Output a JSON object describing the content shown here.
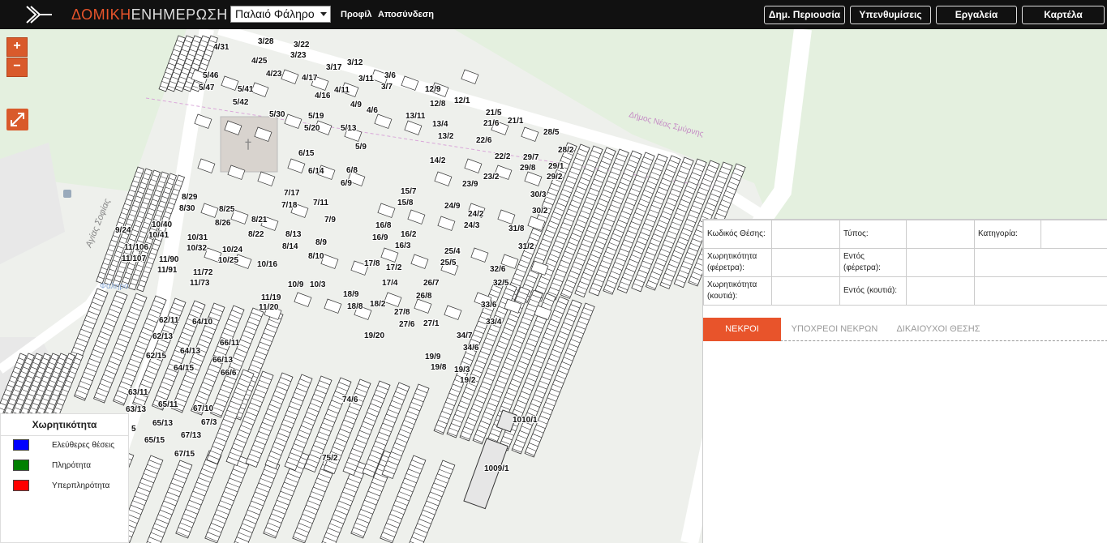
{
  "header": {
    "brand_part1": "ΔΟΜΙΚΗ",
    "brand_part2": "ΕΝΗΜΕΡΩΣΗ",
    "location_select": "Παλαιό Φάληρο",
    "profile_link": "Προφίλ",
    "logout_link": "Αποσύνδεση",
    "buttons": [
      "Δημ. Περιουσία",
      "Υπενθυμίσεις",
      "Εργαλεία",
      "Καρτέλα"
    ]
  },
  "map": {
    "zoom_in": "+",
    "zoom_out": "−",
    "street_labels": [
      "Αγίας Σοφίας",
      "Δήμος Νέας Σμύρνης",
      "Φαληρο"
    ],
    "plot_labels": [
      "3/28",
      "3/22",
      "3/23",
      "4/31",
      "4/25",
      "4/23",
      "5/46",
      "5/47",
      "5/41",
      "5/42",
      "4/17",
      "4/16",
      "4/11",
      "3/17",
      "3/12",
      "3/11",
      "3/6",
      "3/7",
      "4/9",
      "4/6",
      "5/30",
      "5/19",
      "5/20",
      "5/13",
      "5/9",
      "12/9",
      "12/8",
      "12/1",
      "13/11",
      "13/4",
      "13/2",
      "21/5",
      "21/6",
      "21/1",
      "22/6",
      "22/2",
      "28/5",
      "28/2",
      "29/7",
      "29/8",
      "29/1",
      "29/2",
      "14/2",
      "6/15",
      "6/14",
      "6/8",
      "6/9",
      "23/2",
      "23/9",
      "30/3",
      "30/2",
      "7/17",
      "7/18",
      "7/11",
      "7/9",
      "8/29",
      "8/30",
      "8/25",
      "8/26",
      "8/21",
      "8/22",
      "8/13",
      "8/14",
      "8/9",
      "8/10",
      "15/7",
      "15/8",
      "24/9",
      "24/2",
      "24/3",
      "31/8",
      "31/2",
      "9/24",
      "10/40",
      "10/41",
      "10/31",
      "10/32",
      "10/24",
      "10/25",
      "10/16",
      "16/8",
      "16/9",
      "16/2",
      "16/3",
      "25/4",
      "25/5",
      "11/106",
      "11/107",
      "11/90",
      "11/91",
      "11/72",
      "11/73",
      "17/8",
      "17/2",
      "17/4",
      "32/6",
      "32/5",
      "26/7",
      "26/8",
      "10/9",
      "10/3",
      "11/19",
      "11/20",
      "18/9",
      "18/8",
      "18/2",
      "27/8",
      "27/6",
      "27/1",
      "33/6",
      "33/4",
      "62/11",
      "62/13",
      "62/15",
      "64/10",
      "64/13",
      "64/15",
      "66/11",
      "66/13",
      "66/6",
      "19/20",
      "19/9",
      "19/8",
      "19/3",
      "19/2",
      "34/7",
      "34/6",
      "63/11",
      "63/13",
      "65/11",
      "65/13",
      "65/15",
      "67/10",
      "67/3",
      "67/13",
      "67/15",
      "74/6",
      "75/2",
      "1010/1",
      "1009/1",
      "5"
    ]
  },
  "legend": {
    "title": "Χωρητικότητα",
    "items": [
      {
        "label": "Ελεύθερες θέσεις",
        "color": "#0000ff"
      },
      {
        "label": "Πληρότητα",
        "color": "#008000"
      },
      {
        "label": "Υπερπληρότητα",
        "color": "#ff0000"
      }
    ]
  },
  "panel": {
    "fields": {
      "code": "Κωδικός Θέσης:",
      "type": "Τύπος:",
      "category": "Κατηγορία:",
      "capacity_coffin": "Χωρητικότητα (φέρετρα):",
      "inside_coffin": "Εντός (φέρετρα):",
      "capacity_box": "Χωρητικότητα (κουτιά):",
      "inside_box": "Εντός (κουτιά):"
    },
    "tabs": [
      "ΝΕΚΡΟΙ",
      "ΥΠΟΧΡΕΟΙ ΝΕΚΡΩΝ",
      "ΔΙΚΑΙΟΥΧΟΙ ΘΕΣΗΣ"
    ]
  },
  "colors": {
    "accent": "#e8542b",
    "topbar": "#111111"
  }
}
